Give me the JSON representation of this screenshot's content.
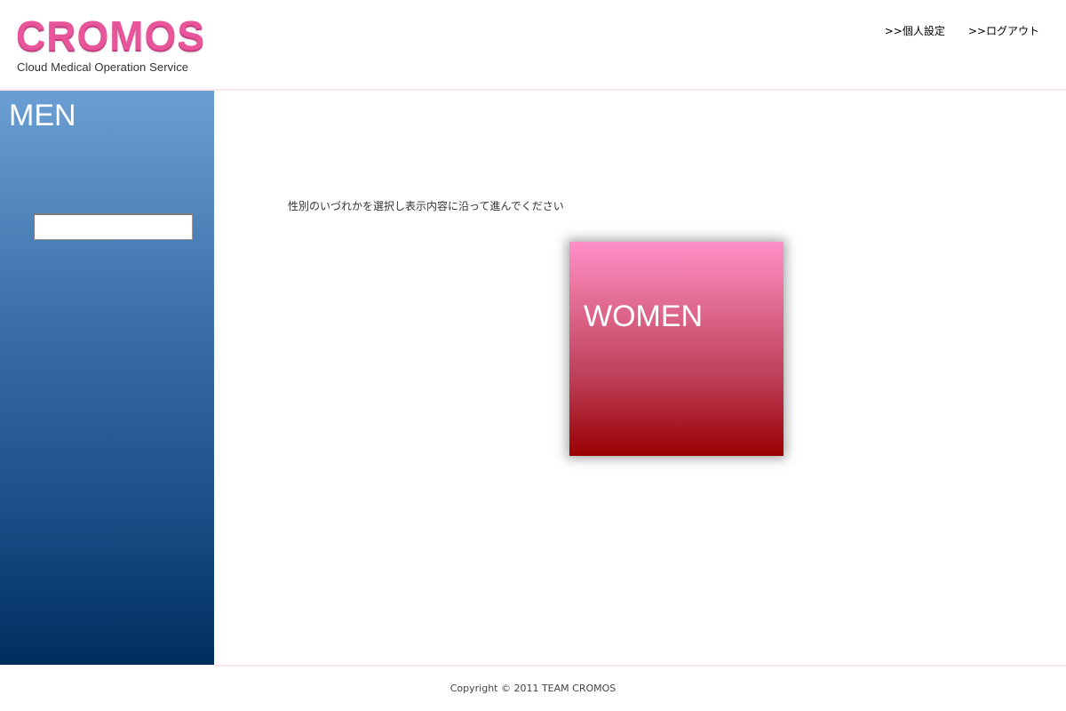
{
  "header": {
    "logo_text": "CROMOS",
    "logo_subtitle": "Cloud Medical Operation Service",
    "links": {
      "settings": ">>個人設定",
      "logout": ">>ログアウト"
    }
  },
  "men_panel": {
    "label": "MEN",
    "input_value": "",
    "input_placeholder": ""
  },
  "main": {
    "instruction": "性別のいづれかを選択し表示内容に沿って進んでください",
    "women_tile": {
      "label": "WOMEN"
    }
  },
  "footer": {
    "copyright": "Copyright © 2011 TEAM CROMOS"
  },
  "colors": {
    "brand_pink": "#e9559a",
    "men_gradient_top": "#6b9fd4",
    "men_gradient_bottom": "#002d5e",
    "women_gradient_top": "#ff90c8",
    "women_gradient_bottom": "#9a0002"
  }
}
